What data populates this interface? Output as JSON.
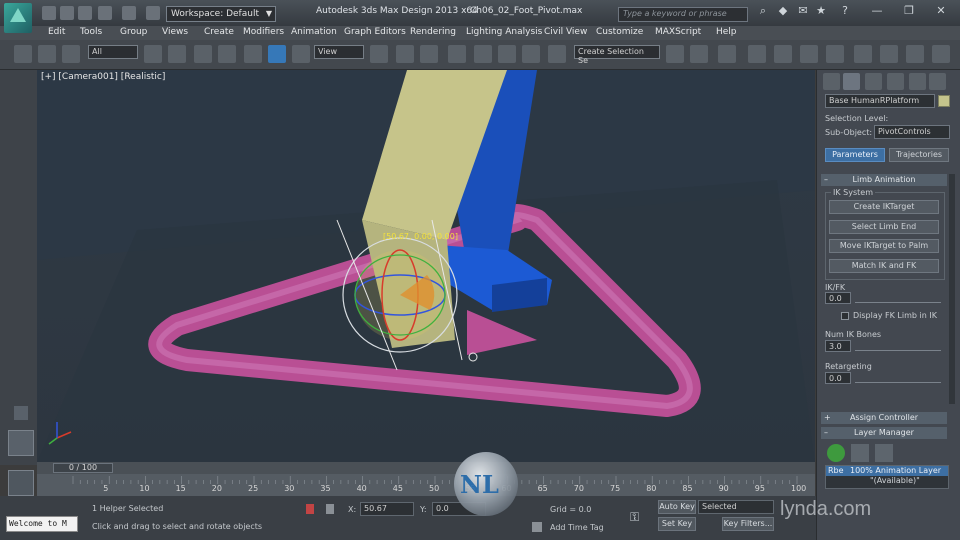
{
  "app": {
    "window_title": "Autodesk 3ds Max Design 2013 x64",
    "file_name": "Ch06_02_Foot_Pivot.max",
    "workspace": "Workspace: Default",
    "search_placeholder": "Type a keyword or phrase"
  },
  "menus": [
    "Edit",
    "Tools",
    "Group",
    "Views",
    "Create",
    "Modifiers",
    "Animation",
    "Graph Editors",
    "Rendering",
    "Lighting Analysis",
    "Civil View",
    "Customize",
    "MAXScript",
    "Help"
  ],
  "toolbar": {
    "selection_filter": "All",
    "ref_coord": "View",
    "named_selection": "Create Selection Se"
  },
  "viewport": {
    "label": "[+] [Camera001] [Realistic]",
    "coord_readout": "[50.67, 0.00, 0.00]"
  },
  "command_panel": {
    "object_name": "Base HumanRPlatform",
    "selection_level_label": "Selection Level:",
    "sub_object_label": "Sub-Object:",
    "sub_object_value": "PivotControls",
    "tab_parameters": "Parameters",
    "tab_trajectories": "Trajectories",
    "rollout_limb": "Limb Animation",
    "group_ik_system": "IK System",
    "btn_create_iktarget": "Create IKTarget",
    "btn_select_limb_end": "Select Limb End",
    "btn_move_iktarget": "Move IKTarget to Palm",
    "btn_match_ik_fk": "Match IK and FK",
    "ikfk_label": "IK/FK",
    "ikfk_value": "0.0",
    "display_fk_label": "Display FK Limb in IK",
    "num_ik_bones_label": "Num IK Bones",
    "num_ik_bones_value": "3.0",
    "retargeting_label": "Retargeting",
    "retargeting_value": "0.0",
    "rollout_assign": "Assign Controller",
    "rollout_layer": "Layer Manager",
    "layer_text": "100% Animation Layer",
    "layer_available": "\"(Available)\"",
    "layer_prefix": "Rbe"
  },
  "timeline": {
    "slider_label": "0 / 100",
    "ticks": [
      "5",
      "10",
      "15",
      "20",
      "25",
      "30",
      "35",
      "40",
      "45",
      "50",
      "55",
      "60",
      "65",
      "70",
      "75",
      "80",
      "85",
      "90",
      "95",
      "100"
    ]
  },
  "status": {
    "maxscript_text": "Welcome to M",
    "selection_status": "1 Helper Selected",
    "prompt": "Click and drag to select and rotate objects",
    "x_label": "X:",
    "x_value": "50.67",
    "y_label": "Y:",
    "y_value": "0.0",
    "grid_label": "Grid = 0.0",
    "add_time_tag": "Add Time Tag",
    "auto_key": "Auto Key",
    "set_key": "Set Key",
    "selected_value": "Selected",
    "key_filters": "Key Filters..."
  },
  "watermark": {
    "logo_text": "NL",
    "brand": "lynda.com"
  },
  "colors": {
    "viewport_bg": "#2f3a45",
    "highlight_blue": "#3678b8",
    "pink_platform": "#c35a9d",
    "blue_foot": "#1a5bd0",
    "yellow_leg": "#c6c48a",
    "gizmo_yellow": "#f4e23c"
  }
}
